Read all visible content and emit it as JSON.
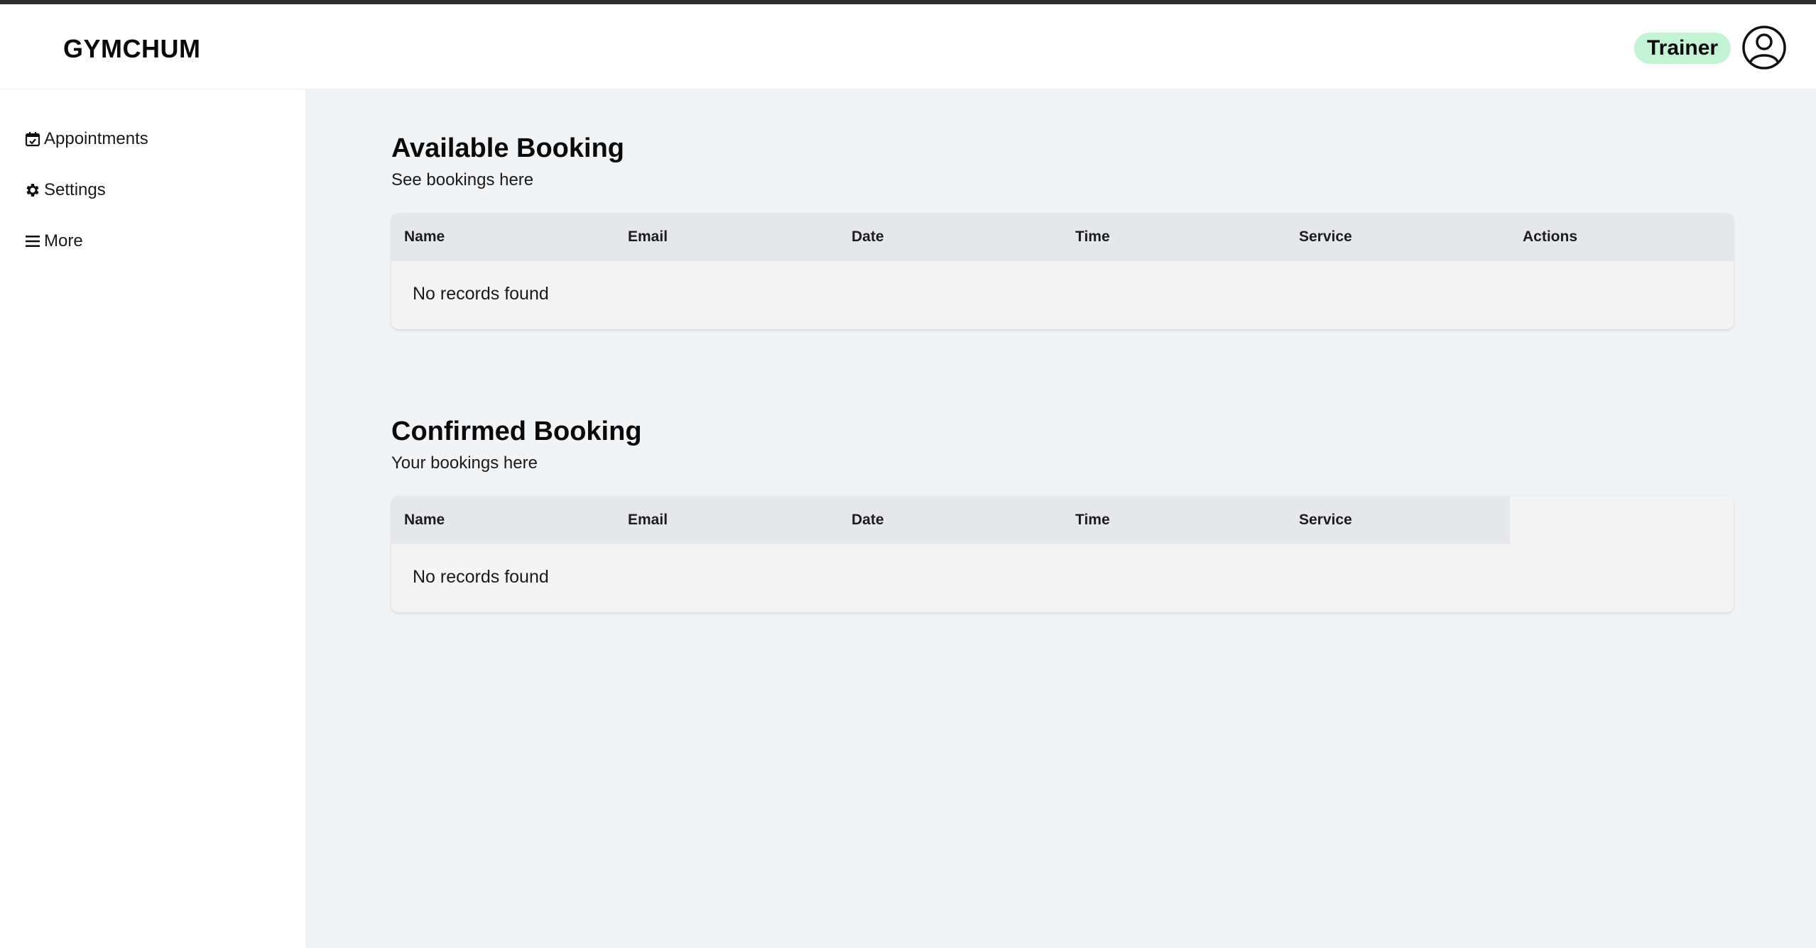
{
  "app": {
    "brand": "GYMCHUM"
  },
  "header": {
    "role_badge": "Trainer",
    "role_badge_color": "#c3f2d4"
  },
  "sidebar": {
    "items": [
      {
        "label": "Appointments",
        "icon": "calendar-check-icon"
      },
      {
        "label": "Settings",
        "icon": "gear-icon"
      },
      {
        "label": "More",
        "icon": "hamburger-menu-icon"
      }
    ]
  },
  "available": {
    "title": "Available Booking",
    "subtitle": "See bookings here",
    "columns": [
      "Name",
      "Email",
      "Date",
      "Time",
      "Service",
      "Actions"
    ],
    "empty_text": "No records found"
  },
  "confirmed": {
    "title": "Confirmed Booking",
    "subtitle": "Your bookings here",
    "columns": [
      "Name",
      "Email",
      "Date",
      "Time",
      "Service"
    ],
    "empty_text": "No records found"
  }
}
